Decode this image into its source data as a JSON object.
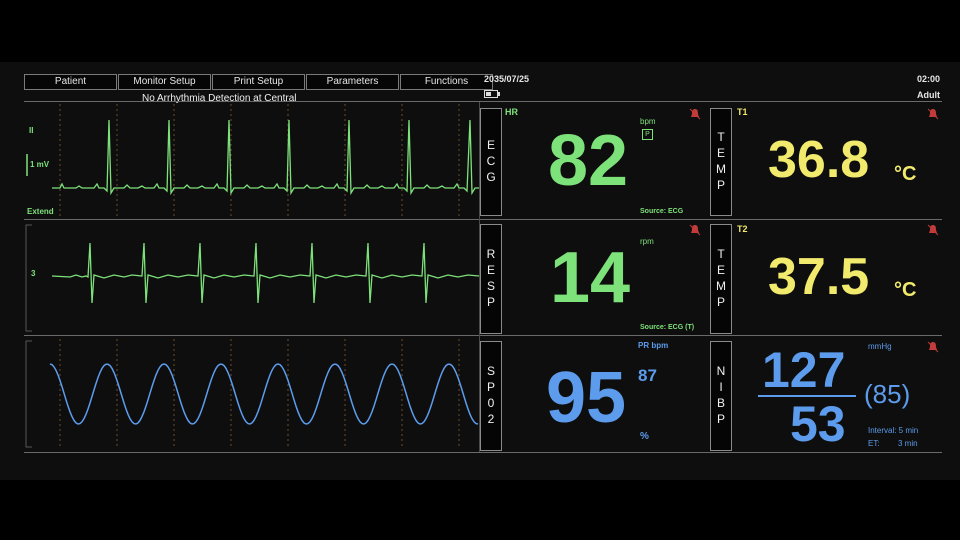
{
  "menu": [
    "Patient",
    "Monitor Setup",
    "Print Setup",
    "Parameters",
    "Functions"
  ],
  "status": {
    "date": "2035/07/25",
    "time": "02:00",
    "patient_type": "Adult"
  },
  "alert_text": "No Arrhythmia Detection at Central",
  "ecg": {
    "lead": "II",
    "scale": "1 mV",
    "mode": "Extend",
    "box": "ECG",
    "label": "HR",
    "value": "82",
    "unit": "bpm",
    "pace": "P",
    "source": "Source: ECG",
    "color": "#7ee27a"
  },
  "resp": {
    "gain": "3",
    "box": "RESP",
    "value": "14",
    "unit": "rpm",
    "source": "Source: ECG (T)",
    "color": "#7ee27a"
  },
  "spo2": {
    "box": "SP02",
    "label": "PR bpm",
    "value": "95",
    "pr": "87",
    "unit": "%",
    "color": "#5d9cec"
  },
  "temp1": {
    "box": "TEMP",
    "label": "T1",
    "value": "36.8",
    "unit": "°C",
    "color": "#f1ea6c"
  },
  "temp2": {
    "box": "TEMP",
    "label": "T2",
    "value": "37.5",
    "unit": "°C",
    "color": "#f1ea6c"
  },
  "nibp": {
    "box": "NIBP",
    "unit": "mmHg",
    "systolic": "127",
    "diastolic": "53",
    "mean": "(85)",
    "interval": "Interval: 5 min",
    "et_label": "ET:",
    "et_value": "3 min",
    "color": "#5d9cec"
  }
}
